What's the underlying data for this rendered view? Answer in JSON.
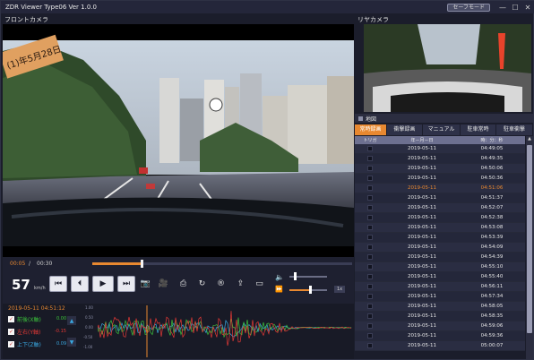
{
  "window": {
    "title": "ZDR Viewer Type06 Ver 1.0.0",
    "safe_mode_label": "セーフモード",
    "minimize": "—",
    "maximize": "☐",
    "close": "✕"
  },
  "labels": {
    "front_camera": "フロントカメラ",
    "rear_camera": "リヤカメラ"
  },
  "video": {
    "sign_text": "(1)年5月28日"
  },
  "playback": {
    "current_time": "00:05",
    "separator": "/",
    "total_time": "00:30",
    "progress": 0.19,
    "speed": "57",
    "speed_unit": "km/h",
    "play_rate": "1x",
    "volume_level": 0.12,
    "rate_level": 0.52
  },
  "sensor": {
    "timestamp": "2019-05-11 04:51:12",
    "axes": [
      {
        "label": "前後(X軸)",
        "value": "0.00",
        "color": "#3cc23c"
      },
      {
        "label": "左右(Y軸)",
        "value": "-0.15",
        "color": "#e53935"
      },
      {
        "label": "上下(Z軸)",
        "value": "0.09",
        "color": "#3aa7e0"
      }
    ],
    "yticks": [
      "1.00",
      "0.50",
      "0.00",
      "-0.50",
      "-1.00"
    ]
  },
  "map": {
    "label": "地図"
  },
  "tabs": [
    {
      "label": "常時録画",
      "active": true
    },
    {
      "label": "衝撃録画",
      "active": false
    },
    {
      "label": "マニュアル",
      "active": false
    },
    {
      "label": "駐車常時",
      "active": false
    },
    {
      "label": "駐車衝撃",
      "active": false
    }
  ],
  "table": {
    "headers": [
      "トリガ",
      "年－月－日",
      "時：分：秒"
    ],
    "rows": [
      {
        "date": "2019-05-11",
        "time": "04:49:05"
      },
      {
        "date": "2019-05-11",
        "time": "04:49:35"
      },
      {
        "date": "2019-05-11",
        "time": "04:50:06"
      },
      {
        "date": "2019-05-11",
        "time": "04:50:36"
      },
      {
        "date": "2019-05-11",
        "time": "04:51:06",
        "selected": true
      },
      {
        "date": "2019-05-11",
        "time": "04:51:37"
      },
      {
        "date": "2019-05-11",
        "time": "04:52:07"
      },
      {
        "date": "2019-05-11",
        "time": "04:52:38"
      },
      {
        "date": "2019-05-11",
        "time": "04:53:08"
      },
      {
        "date": "2019-05-11",
        "time": "04:53:39"
      },
      {
        "date": "2019-05-11",
        "time": "04:54:09"
      },
      {
        "date": "2019-05-11",
        "time": "04:54:39"
      },
      {
        "date": "2019-05-11",
        "time": "04:55:10"
      },
      {
        "date": "2019-05-11",
        "time": "04:55:40"
      },
      {
        "date": "2019-05-11",
        "time": "04:56:11"
      },
      {
        "date": "2019-05-11",
        "time": "04:57:34"
      },
      {
        "date": "2019-05-11",
        "time": "04:58:05"
      },
      {
        "date": "2019-05-11",
        "time": "04:58:35"
      },
      {
        "date": "2019-05-11",
        "time": "04:59:06"
      },
      {
        "date": "2019-05-11",
        "time": "04:59:36"
      },
      {
        "date": "2019-05-11",
        "time": "05:00:07"
      }
    ]
  },
  "icons": {
    "rewind": "rewind-icon",
    "step_back": "step-back-icon",
    "play": "play-icon",
    "step_forward": "step-forward-icon",
    "snapshot": "camera-icon",
    "video": "video-camera-icon",
    "print": "print-icon",
    "rotate": "rotate-icon",
    "record": "record-icon",
    "export": "export-icon",
    "folder": "folder-icon",
    "volume": "speaker-icon",
    "rate": "fast-forward-icon"
  }
}
